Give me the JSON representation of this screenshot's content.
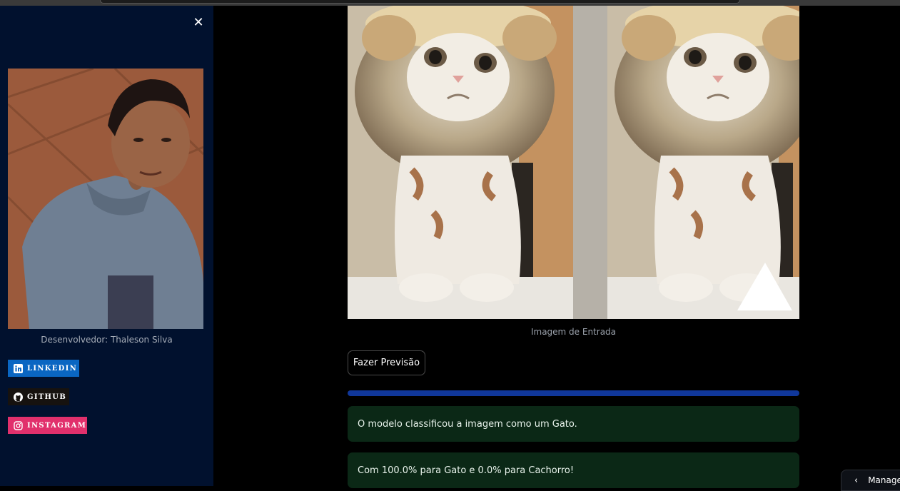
{
  "sidebar": {
    "close_icon": "close-icon",
    "developer_caption": "Desenvolvedor: Thaleson Silva",
    "badges": [
      {
        "label": "LINKEDIN",
        "icon": "linkedin-icon",
        "color": "#0a66c2"
      },
      {
        "label": "GITHUB",
        "icon": "github-icon",
        "color": "#16120f"
      },
      {
        "label": "INSTAGRAM",
        "icon": "instagram-icon",
        "color": "#e1306c"
      }
    ]
  },
  "main": {
    "image_caption": "Imagem de Entrada",
    "predict_button": "Fazer Previsão",
    "progress": 1.0,
    "result_message": "O modelo classificou a imagem como um Gato.",
    "probability_message": "Com 100.0% para Gato e 0.0% para Cachorro!"
  },
  "manage_button": {
    "label": "Manage",
    "icon": "chevron-left-icon"
  },
  "colors": {
    "sidebar_bg": "#01112e",
    "main_bg": "#000000",
    "success_bg": "#0b2816",
    "progress": "#10379a"
  }
}
